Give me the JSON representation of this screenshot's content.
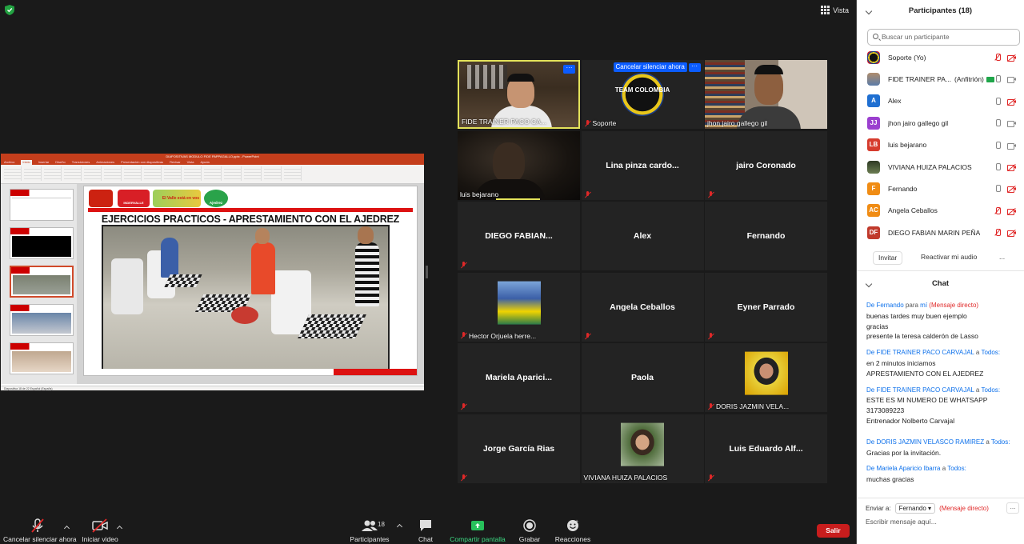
{
  "topbar": {
    "view_label": "Vista"
  },
  "shared_screen": {
    "ppt_title": "DIAPOSITIVAS MODULO FIDE PAPPAGALLO.pptx - PowerPoint",
    "ppt_tabs": [
      "Archivo",
      "Inicio",
      "Insertar",
      "Diseño",
      "Transiciones",
      "Animaciones",
      "Presentación con diapositivas",
      "Revisar",
      "Vista",
      "Ayuda"
    ],
    "slide_title": "EJERCICIOS PRACTICOS - APRESTAMIENTO CON EL AJEDREZ",
    "logo_texts": [
      "INDERVALLE",
      "El Valle está en vos",
      "Ajedrez"
    ],
    "status_text": "Diapositiva 18 de 22   Español (España)"
  },
  "gallery": [
    {
      "name": "FIDE TRAINER PACO CA...",
      "kind": "video",
      "active": true,
      "muted": false
    },
    {
      "name": "Soporte",
      "kind": "logo",
      "muted": true,
      "logo_text": "TEAM COLOMBIA",
      "action": "Cancelar silenciar ahora"
    },
    {
      "name": "jhon jairo gallego gil",
      "kind": "video",
      "muted": false
    },
    {
      "name": "luis bejarano",
      "kind": "video",
      "muted": false
    },
    {
      "name": "Lina  pinza cardo...",
      "kind": "text",
      "muted": true
    },
    {
      "name": "jairo Coronado",
      "kind": "text",
      "muted": true
    },
    {
      "name": "DIEGO FABIAN...",
      "kind": "text",
      "muted": true
    },
    {
      "name": "Alex",
      "kind": "text",
      "muted": false
    },
    {
      "name": "Fernando",
      "kind": "text",
      "muted": false
    },
    {
      "name": "Hector Orjuela herre...",
      "kind": "photo",
      "muted": true
    },
    {
      "name": "Angela Ceballos",
      "kind": "text",
      "muted": true
    },
    {
      "name": "Eyner Parrado",
      "kind": "text",
      "muted": true
    },
    {
      "name": "Mariela  Aparici...",
      "kind": "text",
      "muted": true
    },
    {
      "name": "Paola",
      "kind": "text",
      "muted": false
    },
    {
      "name": "DORIS JAZMIN VELA...",
      "kind": "photo",
      "muted": true
    },
    {
      "name": "Jorge García Rias",
      "kind": "text",
      "muted": true
    },
    {
      "name": "VIVIANA HUIZA PALACIOS",
      "kind": "photo",
      "muted": false
    },
    {
      "name": "Luis  Eduardo  Alf...",
      "kind": "text",
      "muted": true
    }
  ],
  "participants": {
    "header": "Participantes (18)",
    "search_placeholder": "Buscar un participante",
    "list": [
      {
        "name": "Soporte (Yo)",
        "avatar": "",
        "avatar_color": "#222",
        "mic": "off",
        "cam": "off"
      },
      {
        "name": "FIDE TRAINER PA...",
        "host": "(Anfitrión)",
        "avatar": "",
        "avatar_color": "#6a8cb0",
        "mic": "on",
        "cam": "on"
      },
      {
        "name": "Alex",
        "avatar": "A",
        "avatar_color": "#1f6fd1",
        "mic": "on",
        "cam": "off"
      },
      {
        "name": "jhon jairo gallego gil",
        "avatar": "JJ",
        "avatar_color": "#9b3fcf",
        "mic": "on",
        "cam": "on"
      },
      {
        "name": "luis bejarano",
        "avatar": "LB",
        "avatar_color": "#d63b2d",
        "mic": "on",
        "cam": "on"
      },
      {
        "name": "VIVIANA HUIZA PALACIOS",
        "avatar": "",
        "avatar_color": "#4b5b3a",
        "mic": "on",
        "cam": "off"
      },
      {
        "name": "Fernando",
        "avatar": "F",
        "avatar_color": "#f08c14",
        "mic": "on",
        "cam": "off"
      },
      {
        "name": "Angela Ceballos",
        "avatar": "AC",
        "avatar_color": "#f08c14",
        "mic": "off",
        "cam": "off"
      },
      {
        "name": "DIEGO FABIAN MARIN PEÑA",
        "avatar": "DF",
        "avatar_color": "#c0392b",
        "mic": "off",
        "cam": "off"
      }
    ],
    "invite_label": "Invitar",
    "unmute_label": "Reactivar mi audio",
    "more_label": "..."
  },
  "chat": {
    "header": "Chat",
    "messages": [
      {
        "prefix": "De ",
        "from": "Fernando",
        "mid": " para ",
        "to": "mí",
        "dm": " (Mensaje directo)",
        "lines": [
          "buenas tardes  muy buen ejemplo",
          "gracias",
          "presente la teresa calderón de Lasso"
        ]
      },
      {
        "prefix": "De ",
        "from": "FIDE TRAINER PACO CARVAJAL",
        "mid": " a ",
        "to": "Todos",
        "dm": ":",
        "lines": [
          "en 2 minutos iniciamos",
          "APRESTAMIENTO CON EL AJEDREZ"
        ]
      },
      {
        "prefix": "De ",
        "from": "FIDE TRAINER PACO CARVAJAL",
        "mid": " a ",
        "to": "Todos",
        "dm": ":",
        "lines": [
          "ESTE ES MI NUMERO DE WHATSAPP",
          "3173089223",
          "Entrenador Nolberto Carvajal"
        ]
      },
      {
        "prefix": "De ",
        "from": "DORIS JAZMIN VELASCO RAMIREZ",
        "mid": " a ",
        "to": "Todos",
        "dm": ":",
        "lines": [
          "Gracias por la invitación."
        ]
      },
      {
        "prefix": "De ",
        "from": "Mariela Aparicio Ibarra",
        "mid": " a ",
        "to": "Todos",
        "dm": ":",
        "lines": [
          "muchas gracias"
        ]
      }
    ],
    "send_to_label": "Enviar a:",
    "send_to_value": "Fernando",
    "send_to_dm": "(Mensaje directo)",
    "input_placeholder": "Escribir mensaje aquí..."
  },
  "toolbar": {
    "unmute_label": "Cancelar silenciar ahora",
    "video_label": "Iniciar video",
    "participants_label": "Participantes",
    "participants_count": "18",
    "chat_label": "Chat",
    "share_label": "Compartir pantalla",
    "record_label": "Grabar",
    "reactions_label": "Reacciones",
    "leave_label": "Salir"
  }
}
